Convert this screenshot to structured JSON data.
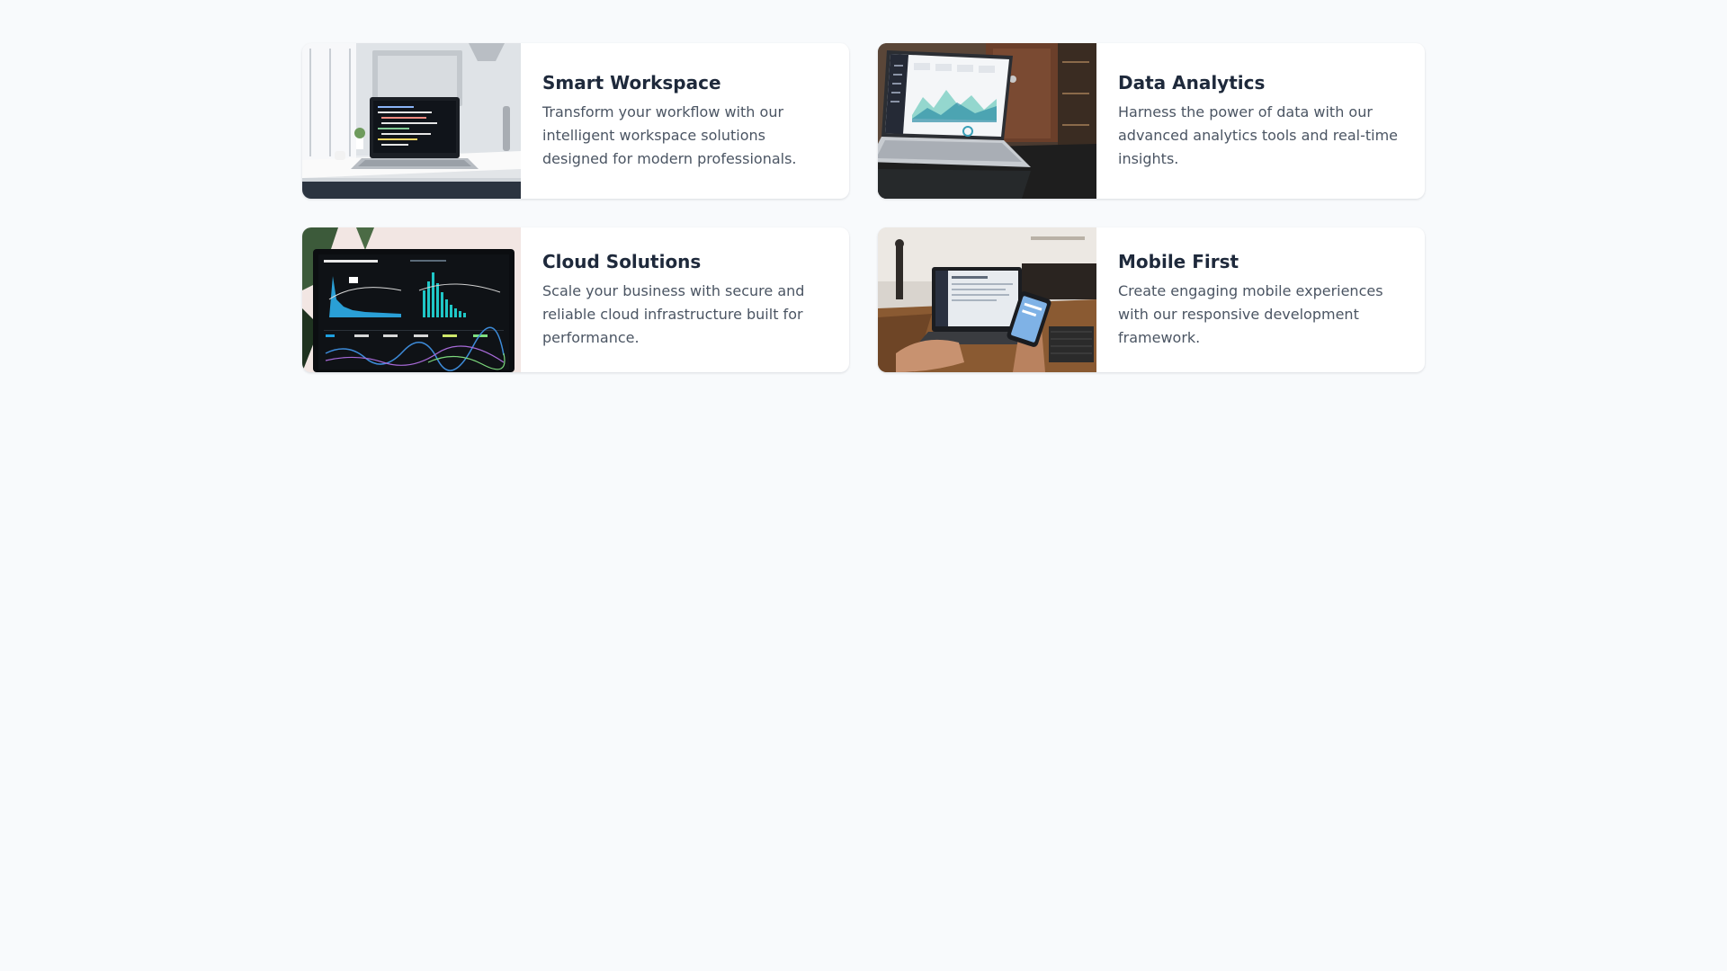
{
  "cards": [
    {
      "title": "Smart Workspace",
      "description": "Transform your workflow with our intelligent workspace solutions designed for modern professionals.",
      "image": "laptop-desk-photo"
    },
    {
      "title": "Data Analytics",
      "description": "Harness the power of data with our advanced analytics tools and real-time insights.",
      "image": "analytics-laptop-photo"
    },
    {
      "title": "Cloud Solutions",
      "description": "Scale your business with secure and reliable cloud infrastructure built for performance.",
      "image": "dashboard-monitor-photo"
    },
    {
      "title": "Mobile First",
      "description": "Create engaging mobile experiences with our responsive development framework.",
      "image": "phone-laptop-photo"
    }
  ],
  "colors": {
    "background": "#f8fafc",
    "card": "#ffffff",
    "title": "#1e293b",
    "text": "#4b5563"
  }
}
